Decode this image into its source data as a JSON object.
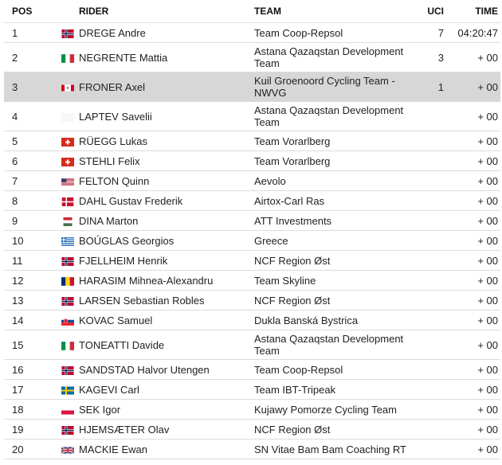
{
  "headers": {
    "pos": "POS",
    "rider": "RIDER",
    "team": "TEAM",
    "uci": "UCI",
    "time": "TIME"
  },
  "rows": [
    {
      "pos": "1",
      "flag": "norway-flag",
      "rider": "DREGE Andre",
      "team": "Team Coop-Repsol",
      "uci": "7",
      "time": "04:20:47"
    },
    {
      "pos": "2",
      "flag": "italy-flag",
      "rider": "NEGRENTE Mattia",
      "team": "Astana Qazaqstan Development Team",
      "uci": "3",
      "time": "+ 00"
    },
    {
      "pos": "3",
      "flag": "canada-flag",
      "rider": "FRONER Axel",
      "team": "Kuil Groenoord Cycling Team - NWVG",
      "uci": "1",
      "time": "+ 00",
      "highlight": true
    },
    {
      "pos": "4",
      "flag": "white-flag",
      "rider": "LAPTEV Savelii",
      "team": "Astana Qazaqstan Development Team",
      "uci": "",
      "time": "+ 00"
    },
    {
      "pos": "5",
      "flag": "switzerland-flag",
      "rider": "RÜEGG Lukas",
      "team": "Team Vorarlberg",
      "uci": "",
      "time": "+ 00"
    },
    {
      "pos": "6",
      "flag": "switzerland-flag",
      "rider": "STEHLI Felix",
      "team": "Team Vorarlberg",
      "uci": "",
      "time": "+ 00"
    },
    {
      "pos": "7",
      "flag": "usa-flag",
      "rider": "FELTON Quinn",
      "team": "Aevolo",
      "uci": "",
      "time": "+ 00"
    },
    {
      "pos": "8",
      "flag": "denmark-flag",
      "rider": "DAHL Gustav Frederik",
      "team": "Airtox-Carl Ras",
      "uci": "",
      "time": "+ 00"
    },
    {
      "pos": "9",
      "flag": "hungary-flag",
      "rider": "DINA Marton",
      "team": "ATT Investments",
      "uci": "",
      "time": "+ 00"
    },
    {
      "pos": "10",
      "flag": "greece-flag",
      "rider": "BOÚGLAS Georgios",
      "team": "Greece",
      "uci": "",
      "time": "+ 00"
    },
    {
      "pos": "11",
      "flag": "norway-flag",
      "rider": "FJELLHEIM Henrik",
      "team": "NCF Region Øst",
      "uci": "",
      "time": "+ 00"
    },
    {
      "pos": "12",
      "flag": "romania-flag",
      "rider": "HARASIM Mihnea-Alexandru",
      "team": "Team Skyline",
      "uci": "",
      "time": "+ 00"
    },
    {
      "pos": "13",
      "flag": "norway-flag",
      "rider": "LARSEN Sebastian Robles",
      "team": "NCF Region Øst",
      "uci": "",
      "time": "+ 00"
    },
    {
      "pos": "14",
      "flag": "slovakia-flag",
      "rider": "KOVAC Samuel",
      "team": "Dukla Banská Bystrica",
      "uci": "",
      "time": "+ 00"
    },
    {
      "pos": "15",
      "flag": "italy-flag",
      "rider": "TONEATTI Davide",
      "team": "Astana Qazaqstan Development Team",
      "uci": "",
      "time": "+ 00"
    },
    {
      "pos": "16",
      "flag": "norway-flag",
      "rider": "SANDSTAD Halvor Utengen",
      "team": "Team Coop-Repsol",
      "uci": "",
      "time": "+ 00"
    },
    {
      "pos": "17",
      "flag": "sweden-flag",
      "rider": "KAGEVI Carl",
      "team": "Team IBT-Tripeak",
      "uci": "",
      "time": "+ 00"
    },
    {
      "pos": "18",
      "flag": "poland-flag",
      "rider": "SEK Igor",
      "team": "Kujawy Pomorze Cycling Team",
      "uci": "",
      "time": "+ 00"
    },
    {
      "pos": "19",
      "flag": "norway-flag",
      "rider": "HJEMSÆTER Olav",
      "team": "NCF Region Øst",
      "uci": "",
      "time": "+ 00"
    },
    {
      "pos": "20",
      "flag": "uk-flag",
      "rider": "MACKIE Ewan",
      "team": "SN Vitae Bam Bam Coaching RT",
      "uci": "",
      "time": "+ 00"
    }
  ],
  "colors": {
    "highlight_row": "#d7d7d7",
    "border": "#dcdcdc"
  }
}
